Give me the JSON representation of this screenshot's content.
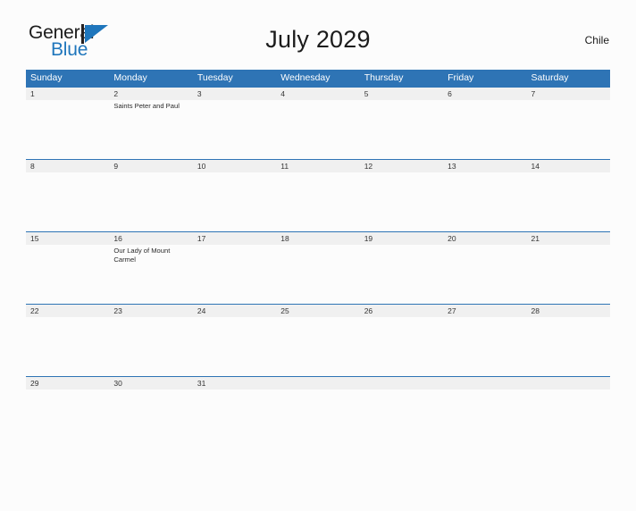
{
  "brand": {
    "name_part1": "General",
    "name_part2": "Blue",
    "logo_icon": "triangle-flag-icon"
  },
  "header": {
    "title": "July 2029",
    "region": "Chile"
  },
  "colors": {
    "header_blue": "#2E74B5",
    "band_gray": "#F0F0F0",
    "logo_blue": "#1F76BC",
    "page_bg": "#FCFCFC",
    "text_dark": "#1B1B1B"
  },
  "calendar": {
    "weekdays": [
      "Sunday",
      "Monday",
      "Tuesday",
      "Wednesday",
      "Thursday",
      "Friday",
      "Saturday"
    ],
    "weeks": [
      {
        "days": [
          {
            "number": "1",
            "event": ""
          },
          {
            "number": "2",
            "event": "Saints Peter and Paul"
          },
          {
            "number": "3",
            "event": ""
          },
          {
            "number": "4",
            "event": ""
          },
          {
            "number": "5",
            "event": ""
          },
          {
            "number": "6",
            "event": ""
          },
          {
            "number": "7",
            "event": ""
          }
        ]
      },
      {
        "days": [
          {
            "number": "8",
            "event": ""
          },
          {
            "number": "9",
            "event": ""
          },
          {
            "number": "10",
            "event": ""
          },
          {
            "number": "11",
            "event": ""
          },
          {
            "number": "12",
            "event": ""
          },
          {
            "number": "13",
            "event": ""
          },
          {
            "number": "14",
            "event": ""
          }
        ]
      },
      {
        "days": [
          {
            "number": "15",
            "event": ""
          },
          {
            "number": "16",
            "event": "Our Lady of Mount Carmel"
          },
          {
            "number": "17",
            "event": ""
          },
          {
            "number": "18",
            "event": ""
          },
          {
            "number": "19",
            "event": ""
          },
          {
            "number": "20",
            "event": ""
          },
          {
            "number": "21",
            "event": ""
          }
        ]
      },
      {
        "days": [
          {
            "number": "22",
            "event": ""
          },
          {
            "number": "23",
            "event": ""
          },
          {
            "number": "24",
            "event": ""
          },
          {
            "number": "25",
            "event": ""
          },
          {
            "number": "26",
            "event": ""
          },
          {
            "number": "27",
            "event": ""
          },
          {
            "number": "28",
            "event": ""
          }
        ]
      },
      {
        "days": [
          {
            "number": "29",
            "event": ""
          },
          {
            "number": "30",
            "event": ""
          },
          {
            "number": "31",
            "event": ""
          },
          {
            "number": "",
            "event": ""
          },
          {
            "number": "",
            "event": ""
          },
          {
            "number": "",
            "event": ""
          },
          {
            "number": "",
            "event": ""
          }
        ]
      }
    ]
  }
}
